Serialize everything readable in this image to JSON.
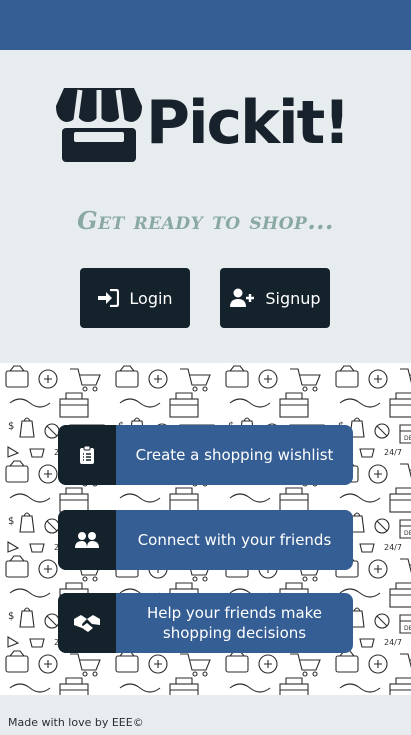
{
  "app": {
    "name": "Pickit!"
  },
  "hero": {
    "tagline": "Get ready to shop..."
  },
  "actions": {
    "login_label": "Login",
    "signup_label": "Signup"
  },
  "features": [
    {
      "icon": "clipboard-list-icon",
      "label": "Create a shopping wishlist"
    },
    {
      "icon": "users-icon",
      "label": "Connect with your friends"
    },
    {
      "icon": "handshake-icon",
      "label": "Help your friends make shopping decisions"
    }
  ],
  "footer": {
    "text": "Made with love by EEE©"
  },
  "colors": {
    "topbar": "#355e94",
    "background": "#e7ecef",
    "dark": "#14222b",
    "accent": "#355e94",
    "tagline": "#8aa9a3"
  }
}
